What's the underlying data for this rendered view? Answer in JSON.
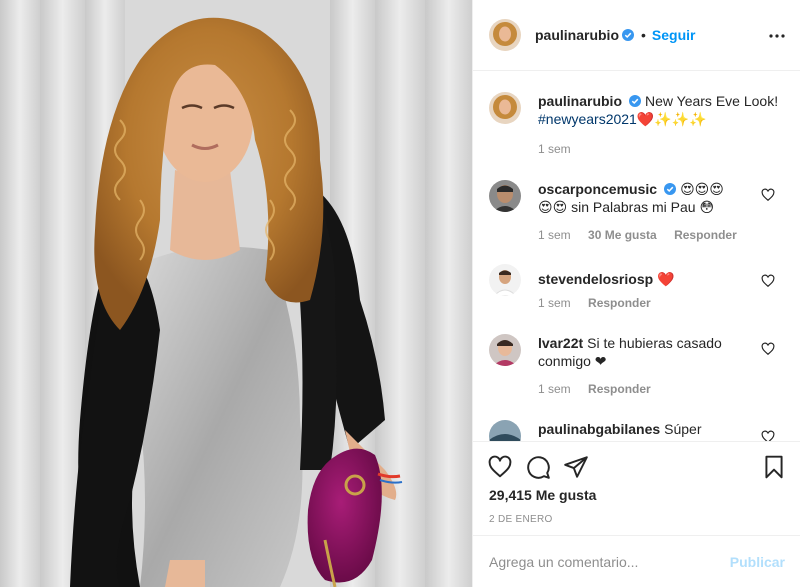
{
  "header": {
    "username": "paulinarubio",
    "dot": "•",
    "follow_label": "Seguir",
    "more_icon": "more-horizontal-icon"
  },
  "caption": {
    "username": "paulinarubio",
    "text": "New Years Eve Look!",
    "hashtag": "#newyears2021",
    "emoji": "❤️✨✨✨",
    "time": "1 sem"
  },
  "comments": [
    {
      "username": "oscarponcemusic",
      "verified": true,
      "text_a": "😍😍😍",
      "text_b": "😍😍 sin Palabras mi Pau 😳",
      "time": "1 sem",
      "likes": "30 Me gusta",
      "reply": "Responder"
    },
    {
      "username": "stevendelosriosp",
      "verified": false,
      "text": "❤️",
      "time": "1 sem",
      "reply": "Responder"
    },
    {
      "username": "lvar22t",
      "verified": false,
      "text": "Si te hubieras casado conmigo ❤",
      "time": "1 sem",
      "reply": "Responder"
    },
    {
      "username": "paulinabgabilanes",
      "verified": false,
      "text": "Súper"
    }
  ],
  "actions": {
    "like_icon": "heart-icon",
    "comment_icon": "comment-icon",
    "share_icon": "send-icon",
    "save_icon": "bookmark-icon"
  },
  "likes_count": "29,415 Me gusta",
  "date": "2 DE ENERO",
  "add_comment": {
    "placeholder": "Agrega un comentario...",
    "value": "",
    "publish_label": "Publicar"
  },
  "colors": {
    "accent": "#0095f6",
    "verified": "#3897f0",
    "publish_disabled": "#b2dffc",
    "muted": "#8e8e8e",
    "text": "#262626",
    "heart": "#ed4956",
    "purse": "#8e1463"
  }
}
